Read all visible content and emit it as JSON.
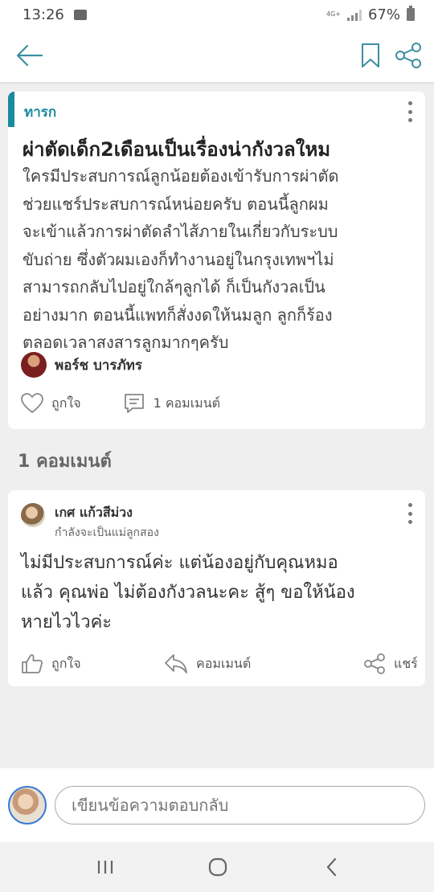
{
  "status": {
    "time": "13:26",
    "network": "4G+",
    "battery": "67%"
  },
  "icons": {
    "back": "arrow-left-icon",
    "bookmark": "bookmark-icon",
    "share": "share-icon",
    "like": "heart-icon",
    "comment": "comment-icon",
    "thumb": "thumbs-up-icon",
    "reply": "reply-icon",
    "more": "more-vertical-icon"
  },
  "post": {
    "category": "ทารก",
    "title": "ผ่าตัดเด็ก2เดือนเป็นเรื่องน่ากังวลใหม",
    "body_lines": [
      "ใครมีประสบการณ์ลูกน้อยต้องเข้ารับการผ่าตัด",
      "ช่วยแชร์ประสบการณ์หน่อยครับ ตอนนี้ลูกผม",
      "จะเข้าแล้วการผ่าตัดลำไส้ภายในเกี่ยวกับระบบ",
      "ขับถ่าย ซึ่งตัวผมเองก็ทำงานอยู่ในกรุงเทพฯไม่",
      "สามารถกลับไปอยู่ใกล้ๆลูกได้ ก็เป็นกังวลเป็น",
      "อย่างมาก  ตอนนี้แพทก็สั่งงดให้นมลูก ลูกก็ร้อง",
      "ตลอดเวลาสงสารลูกมากๆครับ"
    ],
    "author": "พอร์ช บารภัทร",
    "like_label": "ถูกใจ",
    "comment_label": "1 คอมเมนต์"
  },
  "comments_header": "1 คอมเมนต์",
  "comment": {
    "name": "เกศ แก้วสีม่วง",
    "subtitle": "กำลังจะเป็นแม่ลูกสอง",
    "text_lines": [
      "ไม่มีประสบการณ์ค่ะ แต่น้องอยู่กับคุณหมอ",
      "แล้ว คุณพ่อ ไม่ต้องกังวลนะคะ สู้ๆ ขอให้น้อง",
      "หายไวไวค่ะ"
    ],
    "like_label": "ถูกใจ",
    "reply_label": "คอมเมนต์",
    "share_label": "แชร์"
  },
  "reply_box": {
    "placeholder": "เขียนข้อความตอบกลับ"
  },
  "colors": {
    "accent": "#1a8a9e",
    "background": "#efefef"
  }
}
